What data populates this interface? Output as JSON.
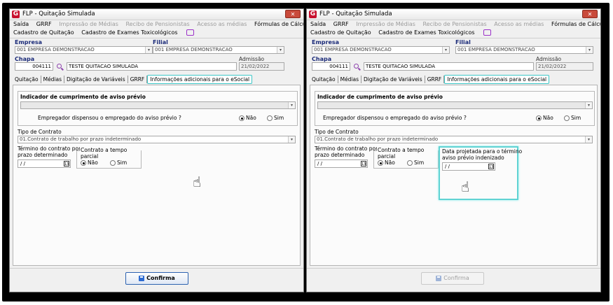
{
  "windows": [
    {
      "title": "FLP - Quitação Simulada",
      "close_label": "✕",
      "menu": [
        {
          "label": "Saída",
          "enabled": true
        },
        {
          "label": "GRRF",
          "enabled": true
        },
        {
          "label": "Impressão de Médias",
          "enabled": false
        },
        {
          "label": "Recibo de Pensionistas",
          "enabled": false
        },
        {
          "label": "Acesso as médias",
          "enabled": false
        },
        {
          "label": "Fórmulas de Cálculos",
          "enabled": true
        }
      ],
      "menu2": [
        "Cadastro de Quitação",
        "Cadastro de Exames Toxicológicos"
      ],
      "empresa_label": "Empresa",
      "empresa_value": "001 EMPRESA DEMONSTRACAO",
      "filial_label": "Filial",
      "filial_value": "001 EMPRESA DEMONSTRACAO",
      "chapa_label": "Chapa",
      "chapa_value": "004111",
      "nome_value": "TESTE QUITACAO SIMULADA",
      "admissao_label": "Admissão",
      "admissao_value": "21/02/2022",
      "tabs": [
        "Quitação",
        "Médias",
        "Digitação de Variáveis",
        "GRRF",
        "Informações adicionais para o eSocial"
      ],
      "aviso_title": "Indicador de cumprimento de aviso prévio",
      "dispensou_label": "Empregador dispensou o empregado do aviso prévio ?",
      "radio_nao": "Não",
      "radio_sim": "Sim",
      "tipo_contrato_label": "Tipo de Contrato",
      "tipo_contrato_value": "01.Contrato de trabalho por prazo indeterminado",
      "termino_label_1": "Término do contrato por",
      "termino_label_2": "prazo determinado",
      "date_empty": " /  /",
      "parcial_title": "Contrato a tempo parcial",
      "confirm_label": "Confirma"
    },
    {
      "title": "FLP - Quitação Simulada",
      "close_label": "✕",
      "menu": [
        {
          "label": "Saída",
          "enabled": true
        },
        {
          "label": "GRRF",
          "enabled": true
        },
        {
          "label": "Impressão de Médias",
          "enabled": false
        },
        {
          "label": "Recibo de Pensionistas",
          "enabled": false
        },
        {
          "label": "Acesso as médias",
          "enabled": false
        },
        {
          "label": "Fórmulas de Cálculos",
          "enabled": true
        }
      ],
      "menu2": [
        "Cadastro de Quitação",
        "Cadastro de Exames Toxicológicos"
      ],
      "empresa_label": "Empresa",
      "empresa_value": "001 EMPRESA DEMONSTRACAO",
      "filial_label": "Filial",
      "filial_value": "001 EMPRESA DEMONSTRACAO",
      "chapa_label": "Chapa",
      "chapa_value": "004111",
      "nome_value": "TESTE QUITACAO SIMULADA",
      "admissao_label": "Admissão",
      "admissao_value": "21/02/2022",
      "tabs": [
        "Quitação",
        "Médias",
        "Digitação de Variáveis",
        "GRRF",
        "Informações adicionais para o eSocial"
      ],
      "aviso_title": "Indicador de cumprimento de aviso prévio",
      "dispensou_label": "Empregador dispensou o empregado do aviso prévio ?",
      "radio_nao": "Não",
      "radio_sim": "Sim",
      "tipo_contrato_label": "Tipo de Contrato",
      "tipo_contrato_value": "01.Contrato de trabalho por prazo indeterminado",
      "termino_label_1": "Término do contrato por",
      "termino_label_2": "prazo determinado",
      "date_empty": " /  /",
      "parcial_title": "Contrato a tempo parcial",
      "projetada_label_1": "Data projetada para o término",
      "projetada_label_2": "aviso prévio indenizado",
      "confirm_label": "Confirma"
    }
  ],
  "colors": {
    "highlight": "#5fd3d3",
    "label_blue": "#1a2a78",
    "icon_purple": "#8e44ad",
    "app_red": "#c8102e"
  },
  "icons": {
    "app": "g-logo-icon",
    "search": "search-icon",
    "calendar": "calendar-icon",
    "save": "save-icon",
    "pointer": "hand-pointer-icon"
  }
}
